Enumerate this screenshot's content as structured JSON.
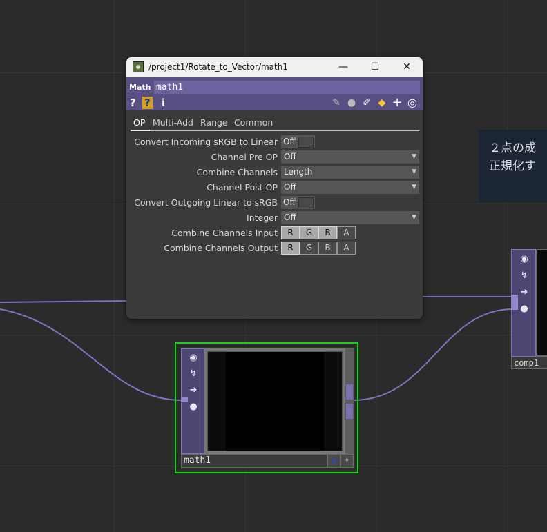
{
  "colors": {
    "background": "#2b2b2b",
    "grid": "#363636",
    "wire": "#7e72c4",
    "node_purple": "#4d4673",
    "selected": "#13d613",
    "dialog_header": "#5a4f83"
  },
  "dialog": {
    "title": "/project1/Rotate_to_Vector/math1",
    "minimize_icon": "—",
    "maximize_icon": "☐",
    "close_icon": "✕",
    "op_type": "Math",
    "op_name": "math1",
    "help_icon": "?",
    "py_help_icon": "?",
    "info_icon": "i",
    "tabs": [
      "OP",
      "Multi-Add",
      "Range",
      "Common"
    ],
    "params": {
      "convert_in": {
        "label": "Convert Incoming sRGB to Linear",
        "value": "Off"
      },
      "channel_pre": {
        "label": "Channel Pre OP",
        "value": "Off"
      },
      "combine": {
        "label": "Combine Channels",
        "value": "Length"
      },
      "channel_post": {
        "label": "Channel Post OP",
        "value": "Off"
      },
      "convert_out": {
        "label": "Convert Outgoing Linear to sRGB",
        "value": "Off"
      },
      "integer": {
        "label": "Integer",
        "value": "Off"
      },
      "combine_input": {
        "label": "Combine Channels Input",
        "channels": [
          "R",
          "G",
          "B",
          "A"
        ],
        "states": [
          true,
          true,
          true,
          false
        ]
      },
      "combine_output": {
        "label": "Combine Channels Output",
        "channels": [
          "R",
          "G",
          "B",
          "A"
        ],
        "states": [
          true,
          false,
          false,
          false
        ]
      }
    }
  },
  "note": {
    "line1": "２点の成",
    "line2": "正規化す"
  },
  "nodes": {
    "math1": {
      "name": "math1"
    },
    "comp1": {
      "name": "comp1"
    }
  }
}
